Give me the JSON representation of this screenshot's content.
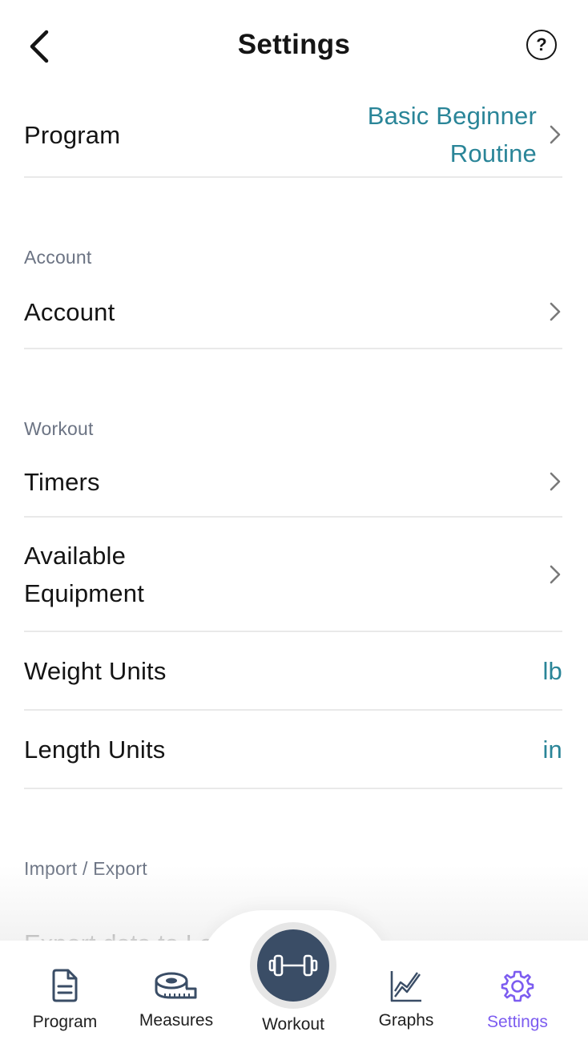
{
  "header": {
    "title": "Settings",
    "back_icon": "chevron-left-icon",
    "help_icon": "help-circle-icon",
    "help_glyph": "?"
  },
  "program_row": {
    "label": "Program",
    "value_line1": "Basic Beginner",
    "value_line2": "Routine"
  },
  "sections": {
    "account": {
      "header": "Account",
      "rows": [
        {
          "label": "Account"
        }
      ]
    },
    "workout": {
      "header": "Workout",
      "rows": [
        {
          "label": "Timers"
        },
        {
          "label_line1": "Available",
          "label_line2": "Equipment"
        },
        {
          "label": "Weight Units",
          "value": "lb"
        },
        {
          "label": "Length Units",
          "value": "in"
        }
      ]
    },
    "import_export": {
      "header": "Import / Export",
      "partial_row": "Export data to Loi"
    }
  },
  "tabbar": {
    "tabs": [
      {
        "label": "Program",
        "icon": "document-icon"
      },
      {
        "label": "Measures",
        "icon": "tape-measure-icon"
      },
      {
        "label": "Workout",
        "icon": "dumbbell-icon"
      },
      {
        "label": "Graphs",
        "icon": "line-chart-icon"
      },
      {
        "label": "Settings",
        "icon": "gear-icon"
      }
    ],
    "active": "Settings"
  },
  "colors": {
    "accent_value": "#2a8598",
    "active_tab": "#7c5cf0",
    "workout_button": "#3a4d66",
    "section_header": "#6b7383"
  }
}
